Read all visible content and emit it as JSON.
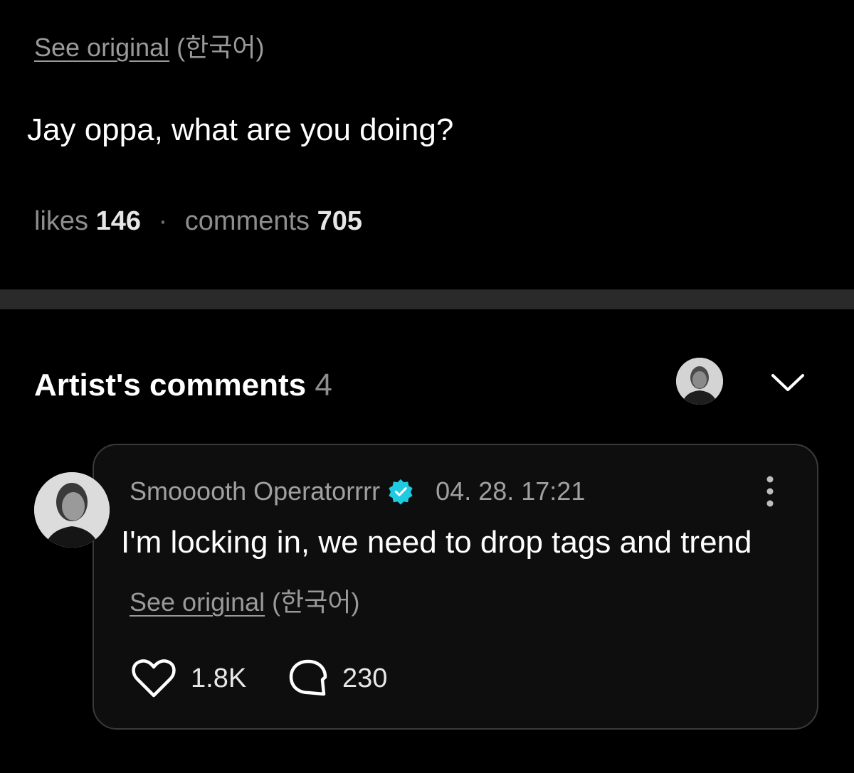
{
  "post": {
    "see_original_link": "See original",
    "see_original_lang": "(한국어)",
    "text": "Jay oppa, what are you doing?",
    "likes_label": "likes",
    "likes_count": "146",
    "separator": "·",
    "comments_label": "comments",
    "comments_count": "705"
  },
  "artist_comments": {
    "title": "Artist's comments",
    "count": "4",
    "avatar_icon": "artist-avatar",
    "toggle_icon": "chevron-down-icon"
  },
  "comment": {
    "author": "Smooooth Operatorrrr",
    "verified_icon": "verified-badge-icon",
    "timestamp": "04. 28. 17:21",
    "text": "I'm locking in, we need to drop tags and trend",
    "see_original_link": "See original",
    "see_original_lang": "(한국어)",
    "likes": "1.8K",
    "replies": "230"
  },
  "colors": {
    "background": "#000000",
    "divider": "#2a2a2a",
    "card_border": "#3a3a3a",
    "verified": "#1ecbe1",
    "muted_text": "#9a9a9a"
  }
}
